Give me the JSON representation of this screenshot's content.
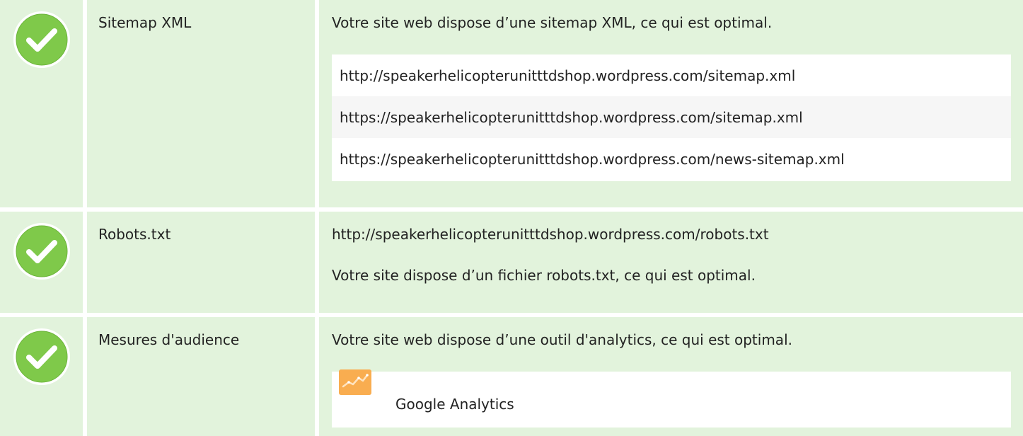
{
  "colors": {
    "row_bg": "#e2f3dc",
    "check_green": "#7fc94a",
    "check_ring": "#ffffff",
    "analytics_orange": "#f7a13a"
  },
  "rows": [
    {
      "label": "Sitemap XML",
      "message": "Votre site web dispose d’une sitemap XML, ce qui est optimal.",
      "items": [
        "http://speakerhelicopterunitttdshop.wordpress.com/sitemap.xml",
        "https://speakerhelicopterunitttdshop.wordpress.com/sitemap.xml",
        "https://speakerhelicopterunitttdshop.wordpress.com/news-sitemap.xml"
      ]
    },
    {
      "label": "Robots.txt",
      "url": "http://speakerhelicopterunitttdshop.wordpress.com/robots.txt",
      "message": "Votre site dispose d’un fichier robots.txt, ce qui est optimal."
    },
    {
      "label": "Mesures d'audience",
      "message": "Votre site web dispose d’une outil d'analytics, ce qui est optimal.",
      "tool": "Google Analytics",
      "tool_icon": "google-analytics-icon"
    }
  ],
  "status_icon": "check-circle-icon"
}
